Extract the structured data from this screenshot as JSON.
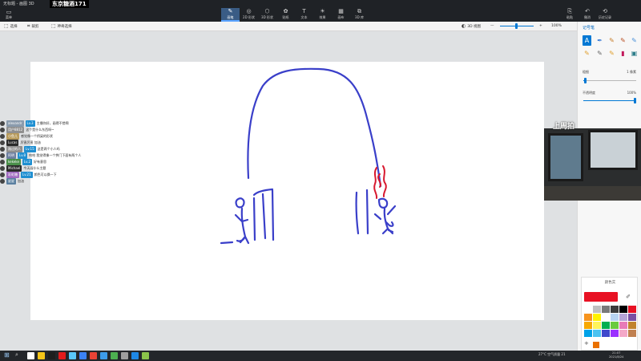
{
  "window": {
    "app_title": "无标题 - 画图 3D",
    "stream_badge": "东京糖酒171"
  },
  "ribbon": {
    "menu_label": "菜单",
    "tabs": [
      {
        "label": "画笔",
        "glyph": "✎"
      },
      {
        "label": "2D 形状",
        "glyph": "◎"
      },
      {
        "label": "3D 形状",
        "glyph": "⬡"
      },
      {
        "label": "贴纸",
        "glyph": "✿"
      },
      {
        "label": "文本",
        "glyph": "T"
      },
      {
        "label": "效果",
        "glyph": "☀"
      },
      {
        "label": "画布",
        "glyph": "▦"
      },
      {
        "label": "3D 库",
        "glyph": "⧉"
      }
    ],
    "right_tools": [
      {
        "label": "粘贴",
        "glyph": "⎘"
      },
      {
        "label": "撤消",
        "glyph": "↶"
      },
      {
        "label": "历史记录",
        "glyph": "⟲"
      }
    ]
  },
  "toolbar": {
    "select_label": "选择",
    "crop_label": "裁剪",
    "magic_select_label": "神奇选择",
    "view_3d_label": "3D 视图",
    "zoom_minus": "—",
    "zoom_plus": "+",
    "zoom_value": "100%",
    "zoom_level": 0.45
  },
  "panel": {
    "title": "记号笔",
    "thickness_label": "粗细",
    "thickness_value": "1 像素",
    "thickness_level": 0.02,
    "opacity_label": "不透明度",
    "opacity_value": "100%",
    "opacity_level": 1.0,
    "colors_title": "颜色实",
    "current_color": "#e81123",
    "swatches": [
      "#ffffff",
      "#c0c0c0",
      "#7a7a7a",
      "#3b3b3b",
      "#000000",
      "#e81123",
      "#f7941d",
      "#fff200",
      "#ffffff",
      "#b8d4f2",
      "#b5a3d6",
      "#7a4fa3",
      "#f7a800",
      "#fff45a",
      "#00b050",
      "#6acb3f",
      "#e87ab8",
      "#c1832e",
      "#00a2e8",
      "#4cc3f1",
      "#3f48cc",
      "#9b30ff",
      "#f4a8c8",
      "#c08050"
    ],
    "add_symbol": "+",
    "add_color": "#ea7100"
  },
  "webcam": {
    "caption": "上周拍"
  },
  "chat": [
    {
      "name": "alexandr",
      "name_color": "#8a9bad",
      "badge": "Lv.3",
      "text": "主播你好，画得不错啊"
    },
    {
      "name": "用户8812",
      "name_color": "#8f8f8f",
      "badge": "",
      "text": "这个是什么东西呀~"
    },
    {
      "name": "小鱼儿",
      "name_color": "#b79a5b",
      "badge": "",
      "text": "感觉像一个桥梁的形状"
    },
    {
      "name": "Lucas",
      "name_color": "#2a2a2a",
      "badge": "",
      "text": "厉害厉害 加油"
    },
    {
      "name": "路过的人",
      "name_color": "#8f8f8f",
      "badge": "Lv.15",
      "text": "这是两个小人吗"
    },
    {
      "name": "阿明",
      "name_color": "#6b7ea0",
      "badge": "Lv.8",
      "text": "哈哈 我觉得像一个拱门下面有两个人"
    },
    {
      "name": "kekeke",
      "name_color": "#4a8f4a",
      "badge": "Lv.2",
      "text": "好有意思"
    },
    {
      "name": "Michael",
      "name_color": "#2a2a2a",
      "badge": "",
      "text": "今天画什么主题"
    },
    {
      "name": "彩虹糖",
      "name_color": "#a06ac0",
      "badge": "Lv.21",
      "text": "颜色可以换一下"
    },
    {
      "name": "星星",
      "name_color": "#5a7fa0",
      "badge": "",
      "text": "加油"
    }
  ],
  "taskbar": {
    "apps": [
      "#ffffff",
      "#f5c518",
      "#1e1e1e",
      "#e21b1b",
      "#5ac8fa",
      "#3b82f6",
      "#ea4335",
      "#3d9be9",
      "#4caf50",
      "#9e9e9e",
      "#1e88e5",
      "#8bc34a"
    ],
    "weather": "27°C 空气质量 21",
    "time": "21:07",
    "date": "2021/8/24"
  },
  "colors": {
    "stroke_blue": "#3a3fc9",
    "stroke_red": "#d8182f",
    "accent": "#0078d4"
  }
}
